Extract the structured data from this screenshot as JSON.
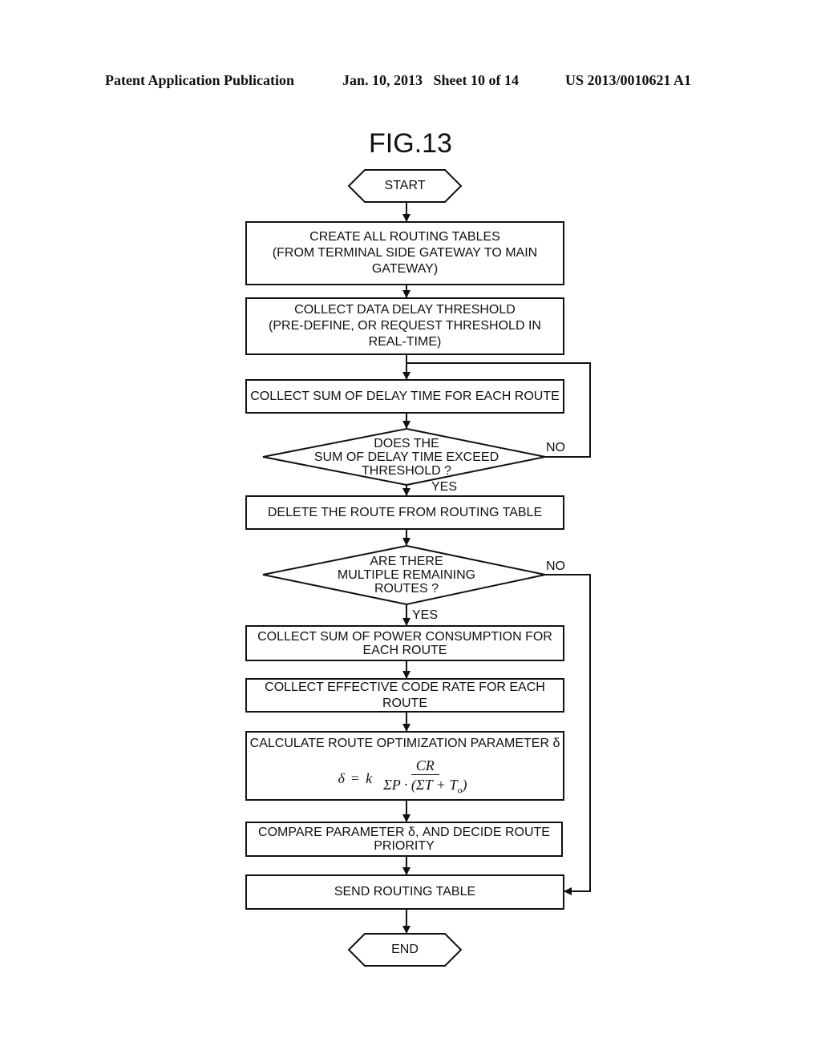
{
  "header": {
    "publication": "Patent Application Publication",
    "date_sheet": "Jan. 10, 2013   Sheet 10 of 14",
    "number": "US 2013/0010621 A1"
  },
  "figure": {
    "title": "FIG.13",
    "terminals": {
      "start": "START",
      "end": "END"
    },
    "steps": {
      "create_tables": [
        "CREATE ALL ROUTING TABLES",
        "(FROM TERMINAL SIDE GATEWAY TO MAIN",
        "GATEWAY)"
      ],
      "collect_threshold": [
        "COLLECT DATA DELAY THRESHOLD",
        "(PRE-DEFINE, OR REQUEST THRESHOLD IN",
        "REAL-TIME)"
      ],
      "collect_delay": "COLLECT SUM OF DELAY TIME FOR EACH ROUTE",
      "delete_route": "DELETE THE ROUTE FROM ROUTING TABLE",
      "collect_power": [
        "COLLECT SUM OF POWER CONSUMPTION FOR",
        "EACH ROUTE"
      ],
      "collect_code_rate": "COLLECT EFFECTIVE CODE RATE FOR EACH ROUTE",
      "calculate_param": "CALCULATE ROUTE OPTIMIZATION PARAMETER δ",
      "formula": {
        "lhs": "δ",
        "equals": "=",
        "coef": "k",
        "numerator": "CR",
        "denominator": "ΣP · (ΣT + T",
        "subscript": "o",
        "close": ")"
      },
      "compare_param": [
        "COMPARE PARAMETER δ, AND DECIDE ROUTE",
        "PRIORITY"
      ],
      "send_table": "SEND ROUTING TABLE"
    },
    "decisions": {
      "exceed_threshold": [
        "DOES THE",
        "SUM OF DELAY TIME EXCEED",
        "THRESHOLD ?"
      ],
      "multiple_routes": [
        "ARE THERE",
        "MULTIPLE REMAINING",
        "ROUTES ?"
      ]
    },
    "labels": {
      "yes": "YES",
      "no": "NO"
    }
  }
}
